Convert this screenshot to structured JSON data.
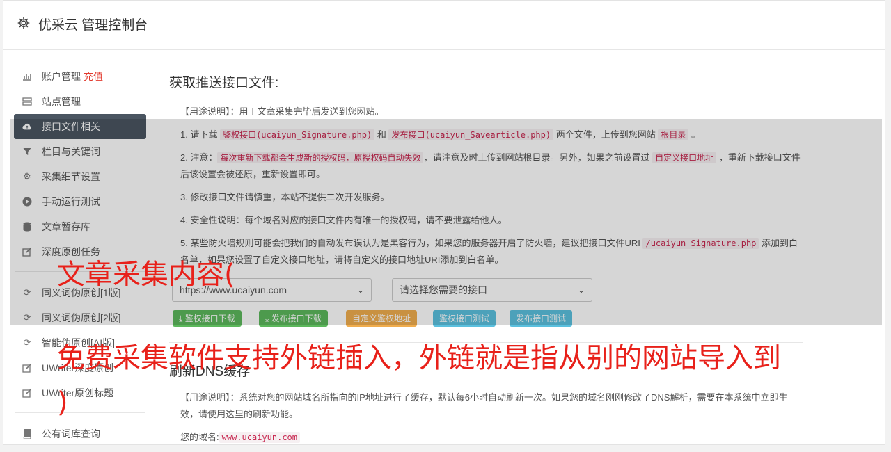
{
  "app": {
    "title": "优采云 管理控制台"
  },
  "sidebar": {
    "items": [
      {
        "icon": "bar-chart-icon",
        "label": "账户管理",
        "badge": "充值"
      },
      {
        "icon": "server-icon",
        "label": "站点管理"
      },
      {
        "icon": "cloud-upload-icon",
        "label": "接口文件相关"
      },
      {
        "icon": "filter-icon",
        "label": "栏目与关键词"
      },
      {
        "icon": "cogs-icon",
        "label": "采集细节设置"
      },
      {
        "icon": "play-icon",
        "label": "手动运行测试"
      },
      {
        "icon": "database-icon",
        "label": "文章暂存库"
      },
      {
        "icon": "edit-icon",
        "label": "深度原创任务"
      },
      {
        "icon": "refresh-icon",
        "label": "同义词伪原创[1版]"
      },
      {
        "icon": "refresh-icon",
        "label": "同义词伪原创[2版]"
      },
      {
        "icon": "refresh-icon",
        "label": "智能伪原创[AI版]"
      },
      {
        "icon": "edit-icon",
        "label": "UWriter深度原创"
      },
      {
        "icon": "edit-icon",
        "label": "UWriter原创标题"
      },
      {
        "icon": "book-icon",
        "label": "公有词库查询"
      }
    ]
  },
  "main": {
    "section1_title": "获取推送接口文件:",
    "usage": "【用途说明】：用于文章采集完毕后发送到您网站。",
    "item1": {
      "a": "1. 请下载 ",
      "c1": "鉴权接口(ucaiyun_Signature.php)",
      "b": " 和 ",
      "c2": "发布接口(ucaiyun_Savearticle.php)",
      "d": " 两个文件，上传到您网站 ",
      "c3": "根目录",
      "e": " 。"
    },
    "item2": {
      "a": "2. 注意：",
      "c1": "每次重新下载都会生成新的授权码，原授权码自动失效",
      "b": "，请注意及时上传到网站根目录。另外，如果之前设置过 ",
      "c2": "自定义接口地址",
      "d": " ，重新下载接口文件后该设置会被还原，重新设置即可。"
    },
    "item3": "3. 修改接口文件请慎重，本站不提供二次开发服务。",
    "item4": "4. 安全性说明：每个域名对应的接口文件内有唯一的授权码，请不要泄露给他人。",
    "item5": {
      "a": "5. 某些防火墙规则可能会把我们的自动发布误认为是黑客行为，如果您的服务器开启了防火墙，建议把接口文件URI ",
      "c1": "/ucaiyun_Signature.php",
      "b": " 添加到白名单，如果您设置了自定义接口地址，请将自定义的接口地址URI添加到白名单。"
    },
    "site_select": "https://www.ucaiyun.com",
    "interface_select": "请选择您需要的接口",
    "buttons": {
      "sign_download": "鉴权接口下载",
      "publish_download": "发布接口下载",
      "custom_url": "自定义鉴权地址",
      "sign_test": "鉴权接口测试",
      "publish_test": "发布接口测试"
    },
    "section2_title": "刷新DNS缓存",
    "dns_usage": "【用途说明】：系统对您的网站域名所指向的IP地址进行了缓存，默认每6小时自动刷新一次。如果您的域名刚刚修改了DNS解析，需要在本系统中立即生效，请使用这里的刷新功能。",
    "domain_label": "您的域名:",
    "domain_value": "www.ucaiyun.com"
  },
  "captions": {
    "line1": "文章采集内容(",
    "line2": "免费采集软件支持外链插入，外链就是指从别的网站导入到",
    "line3": ")"
  },
  "colors": {
    "accent": "#e23a2e",
    "caption": "#e8211a",
    "active_nav": "#4a5561",
    "success": "#5cb85c",
    "warning": "#f0ad4e",
    "info": "#5bc0de",
    "code": "#c7254e"
  }
}
